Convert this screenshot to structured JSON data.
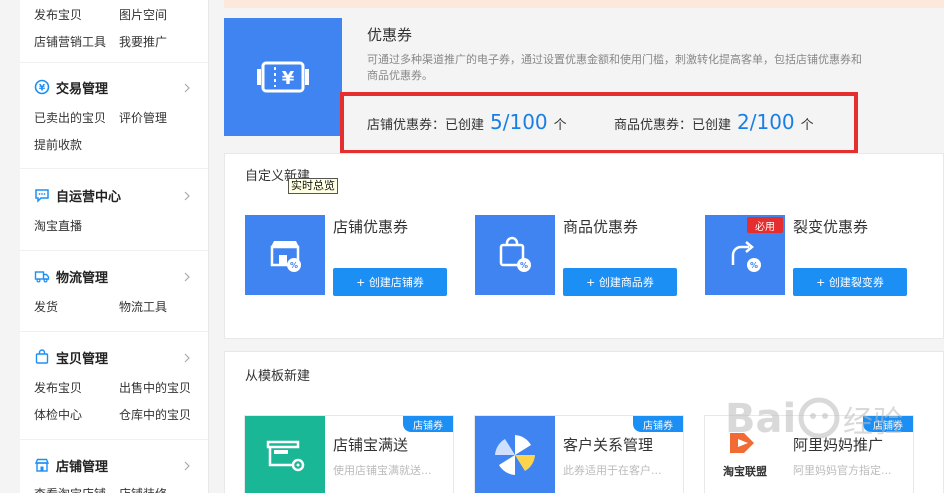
{
  "sidebar": {
    "top_links": [
      "发布宝贝",
      "图片空间",
      "店铺营销工具",
      "我要推广"
    ],
    "groups": [
      {
        "title": "交易管理",
        "icon": "yen-circle-icon",
        "links": [
          "已卖出的宝贝",
          "评价管理",
          "提前收款"
        ]
      },
      {
        "title": "自运营中心",
        "icon": "chat-bubble-icon",
        "links": [
          "淘宝直播"
        ]
      },
      {
        "title": "物流管理",
        "icon": "truck-icon",
        "links": [
          "发货",
          "物流工具"
        ]
      },
      {
        "title": "宝贝管理",
        "icon": "shopping-bag-icon",
        "links": [
          "发布宝贝",
          "出售中的宝贝",
          "体检中心",
          "仓库中的宝贝"
        ]
      },
      {
        "title": "店铺管理",
        "icon": "store-icon",
        "links": [
          "查看淘宝店铺",
          "店铺装修"
        ]
      }
    ]
  },
  "hero": {
    "title": "优惠券",
    "description": "可通过多种渠道推广的电子券，通过设置优惠金额和使用门槛，刺激转化提高客单，包括店铺优惠券和商品优惠券。",
    "stats": [
      {
        "label": "店铺优惠券：已创建",
        "value": "5/100",
        "unit": "个"
      },
      {
        "label": "商品优惠券：已创建",
        "value": "2/100",
        "unit": "个"
      }
    ]
  },
  "custom_section": {
    "title": "自定义新建",
    "tooltip": "实时总览",
    "coupons": [
      {
        "name": "店铺优惠券",
        "button": "+ 创建店铺券",
        "icon": "shop-coupon-icon"
      },
      {
        "name": "商品优惠券",
        "button": "+ 创建商品券",
        "icon": "bag-coupon-icon"
      },
      {
        "name": "裂变优惠券",
        "button": "+ 创建裂变券",
        "icon": "share-coupon-icon",
        "badge": "必用"
      }
    ]
  },
  "template_section": {
    "title": "从模板新建",
    "templates": [
      {
        "name": "店铺宝满送",
        "desc": "使用店铺宝满就送...",
        "tag": "店铺券",
        "icon": "store-gear-icon",
        "icon_bg": "#19b795"
      },
      {
        "name": "客户关系管理",
        "desc": "此券适用于在客户...",
        "tag": "店铺券",
        "icon": "pinwheel-icon",
        "icon_bg": "#3f84f0"
      },
      {
        "name": "阿里妈妈推广",
        "desc": "阿里妈妈官方指定...",
        "tag": "店铺券",
        "icon": "taobao-alliance-icon",
        "icon_bg": "#ffffff",
        "logo_text": "淘宝联盟"
      }
    ]
  },
  "colors": {
    "accent": "#1c8ff5",
    "brand_blue": "#3f84f0",
    "highlight_red": "#e52e2e"
  }
}
